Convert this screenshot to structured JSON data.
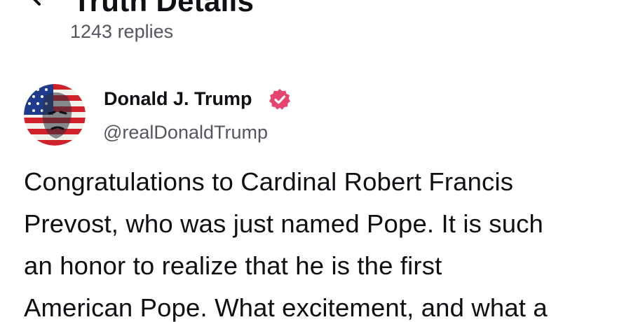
{
  "header": {
    "back_icon": "chevron-left-icon",
    "title": "Truth Details",
    "more_icon": "more-horizontal-icon",
    "replies": "1243 replies"
  },
  "post": {
    "author": {
      "name": "Donald J. Trump",
      "handle": "@realDonaldTrump",
      "verified": true,
      "verified_color": "#e8426f"
    },
    "text_lines": [
      "Congratulations to Cardinal Robert Francis",
      "Prevost, who was just named Pope. It is such",
      "an honor to realize that he is the first",
      "American Pope. What excitement, and what a"
    ]
  }
}
